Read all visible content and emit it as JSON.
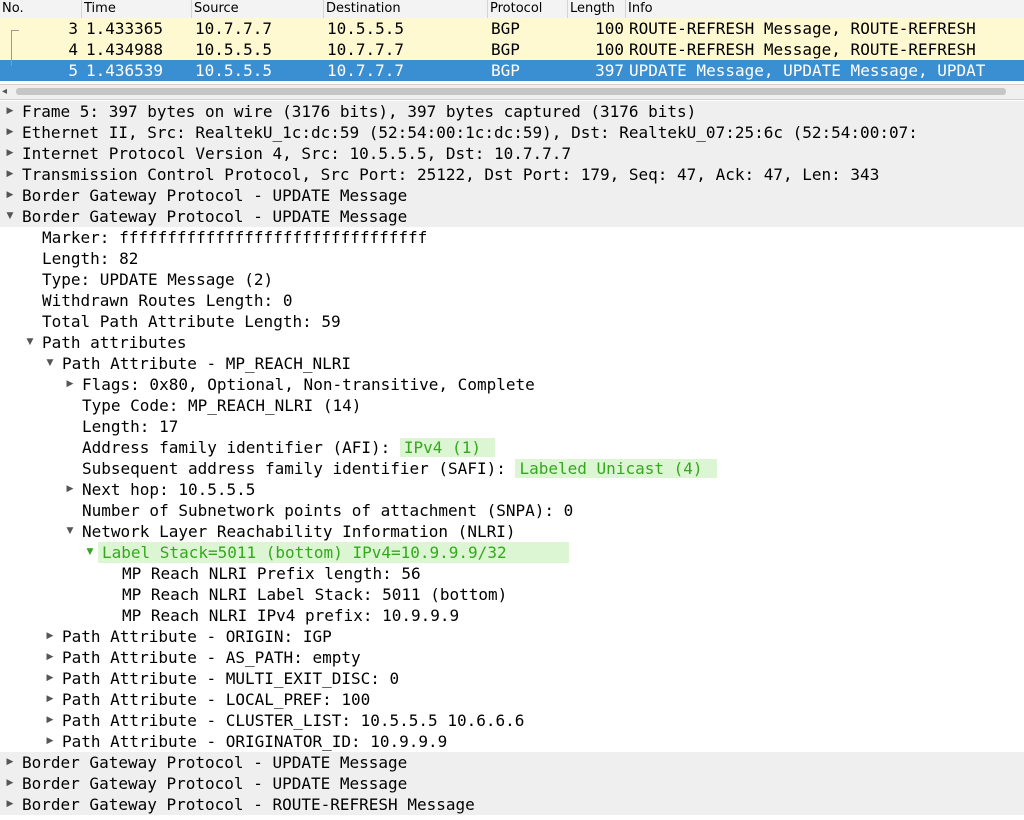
{
  "packet_list": {
    "columns": [
      "No.",
      "Time",
      "Source",
      "Destination",
      "Protocol",
      "Length",
      "Info"
    ],
    "rows": [
      {
        "no": "3",
        "time": "1.433365",
        "source": "10.7.7.7",
        "destination": "10.5.5.5",
        "protocol": "BGP",
        "length": "100",
        "info": "ROUTE-REFRESH Message, ROUTE-REFRESH"
      },
      {
        "no": "4",
        "time": "1.434988",
        "source": "10.5.5.5",
        "destination": "10.7.7.7",
        "protocol": "BGP",
        "length": "100",
        "info": "ROUTE-REFRESH Message, ROUTE-REFRESH"
      },
      {
        "no": "5",
        "time": "1.436539",
        "source": "10.5.5.5",
        "destination": "10.7.7.7",
        "protocol": "BGP",
        "length": "397",
        "info": "UPDATE Message, UPDATE Message, UPDAT"
      }
    ],
    "colors": {
      "bgp_row": "#fff9d2",
      "selected_row": "#3a8fd3"
    }
  },
  "details": {
    "frame": "Frame 5: 397 bytes on wire (3176 bits), 397 bytes captured (3176 bits)",
    "ethernet": "Ethernet II, Src: RealtekU_1c:dc:59 (52:54:00:1c:dc:59), Dst: RealtekU_07:25:6c (52:54:00:07:",
    "ip": "Internet Protocol Version 4, Src: 10.5.5.5, Dst: 10.7.7.7",
    "tcp": "Transmission Control Protocol, Src Port: 25122, Dst Port: 179, Seq: 47, Ack: 47, Len: 343",
    "bgp1": "Border Gateway Protocol - UPDATE Message",
    "bgp2": "Border Gateway Protocol - UPDATE Message",
    "marker": "Marker: ffffffffffffffffffffffffffffffff",
    "length": "Length: 82",
    "type": "Type: UPDATE Message (2)",
    "withdrawn": "Withdrawn Routes Length: 0",
    "total_path": "Total Path Attribute Length: 59",
    "path_attrs": "Path attributes",
    "mp_reach": "Path Attribute - MP_REACH_NLRI",
    "flags": "Flags: 0x80, Optional, Non-transitive, Complete",
    "type_code": "Type Code: MP_REACH_NLRI (14)",
    "attr_length": "Length: 17",
    "afi_label": "Address family identifier (AFI): ",
    "afi_value": "IPv4 (1)",
    "safi_label": "Subsequent address family identifier (SAFI): ",
    "safi_value": "Labeled Unicast (4)",
    "next_hop": "Next hop: 10.5.5.5",
    "snpa": "Number of Subnetwork points of attachment (SNPA): 0",
    "nlri": "Network Layer Reachability Information (NLRI)",
    "label_stack": "Label Stack=5011 (bottom) IPv4=10.9.9.9/32",
    "prefix_len": "MP Reach NLRI Prefix length: 56",
    "nlri_label": "MP Reach NLRI Label Stack: 5011 (bottom)",
    "nlri_prefix": "MP Reach NLRI IPv4 prefix: 10.9.9.9",
    "origin": "Path Attribute - ORIGIN: IGP",
    "as_path": "Path Attribute - AS_PATH: empty",
    "med": "Path Attribute - MULTI_EXIT_DISC: 0",
    "local_pref": "Path Attribute - LOCAL_PREF: 100",
    "cluster": "Path Attribute - CLUSTER_LIST: 10.5.5.5 10.6.6.6",
    "originator": "Path Attribute - ORIGINATOR_ID: 10.9.9.9",
    "bgp3": "Border Gateway Protocol - UPDATE Message",
    "bgp4": "Border Gateway Protocol - UPDATE Message",
    "bgp5": "Border Gateway Protocol - ROUTE-REFRESH Message",
    "icons": {
      "collapsed": "triangle-right-icon",
      "expanded": "triangle-down-icon"
    },
    "colors": {
      "highlight_bg": "#dcf5d2",
      "highlight_fg": "#35a81f",
      "top_level_bg": "#efefef"
    }
  }
}
